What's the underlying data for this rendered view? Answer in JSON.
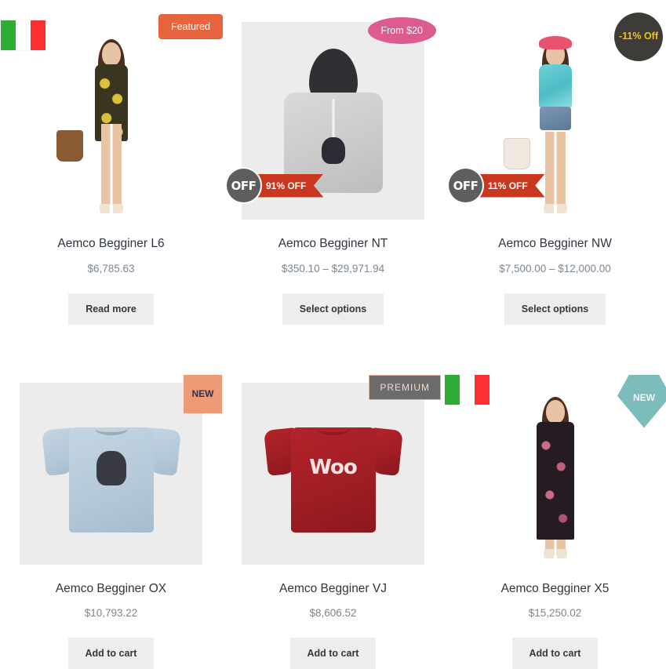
{
  "grid": {
    "columns": 3,
    "rows": [
      {
        "products": [
          {
            "title": "Aemco Begginer L6",
            "price": "$6,785.63",
            "button": "Read more",
            "image_kind": "model-yellow-dress",
            "image_bg": "#ffffff",
            "badges": [
              {
                "kind": "flag",
                "name": "italian-flag",
                "colors": [
                  "#2ead36",
                  "#ffffff",
                  "#fc3030"
                ]
              },
              {
                "kind": "rect-pill",
                "name": "featured",
                "label": "Featured",
                "bg": "#e8643c",
                "color": "#ffffff"
              }
            ]
          },
          {
            "title": "Aemco Begginer NT",
            "price": "$350.10 – $29,971.94",
            "button": "Select options",
            "image_kind": "hoodie-grey",
            "image_bg": "#ececec",
            "badges": [
              {
                "kind": "ellipse",
                "name": "from-price",
                "label": "From $20",
                "bg": "#dd5b8e",
                "color": "#ffffff"
              },
              {
                "kind": "ribbon",
                "name": "discount-ribbon",
                "knob": "OFF",
                "label": "91% OFF",
                "knob_bg": "#5e5e5e",
                "bg": "#c8381f",
                "color": "#ffffff"
              }
            ]
          },
          {
            "title": "Aemco Begginer NW",
            "price": "$7,500.00 – $12,000.00",
            "button": "Select options",
            "image_kind": "model-teal-top",
            "image_bg": "#ffffff",
            "badges": [
              {
                "kind": "circle",
                "name": "discount-circle",
                "label": "-11% Off",
                "bg": "#3e3c38",
                "color": "#f2c116"
              },
              {
                "kind": "ribbon",
                "name": "discount-ribbon",
                "knob": "OFF",
                "label": "11% OFF",
                "knob_bg": "#5e5e5e",
                "bg": "#c8381f",
                "color": "#ffffff"
              }
            ]
          }
        ]
      },
      {
        "products": [
          {
            "title": "Aemco Begginer OX",
            "price": "$10,793.22",
            "button": "Add to cart",
            "image_kind": "tshirt-blue",
            "image_bg": "#ececec",
            "badges": [
              {
                "kind": "square",
                "name": "new-square",
                "label": "NEW",
                "bg": "#ed9a77",
                "color": "#33304a"
              }
            ]
          },
          {
            "title": "Aemco Begginer VJ",
            "price": "$8,606.52",
            "button": "Add to cart",
            "image_kind": "tshirt-red-woo",
            "image_bg": "#ececec",
            "badges": [
              {
                "kind": "rect-outline",
                "name": "premium-badge",
                "label": "PREMIUM",
                "bg": "#6b6b6b",
                "color": "#f4d9d2",
                "border": "#e6b3a5"
              }
            ]
          },
          {
            "title": "Aemco Begginer X5",
            "price": "$15,250.02",
            "button": "Add to cart",
            "image_kind": "model-floral-dress",
            "image_bg": "#ffffff",
            "badges": [
              {
                "kind": "flag",
                "name": "italian-flag",
                "colors": [
                  "#2ead36",
                  "#ffffff",
                  "#fc3030"
                ]
              },
              {
                "kind": "diamond",
                "name": "new-diamond",
                "label": "NEW",
                "bg": "#7cbcbb",
                "color": "#eef7f7"
              }
            ]
          }
        ]
      }
    ]
  },
  "graphics": {
    "hoodie_logo_text": "",
    "woo_shirt_text": "Woo"
  }
}
